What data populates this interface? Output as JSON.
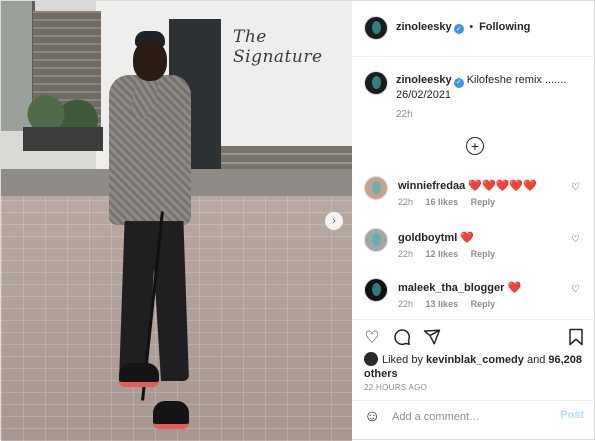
{
  "photo": {
    "sign_text": "The Signature"
  },
  "header": {
    "username": "zinoleesky",
    "separator": "•",
    "follow_state": "Following"
  },
  "caption": {
    "username": "zinoleesky",
    "text": "Kilofeshe remix ....... 26/02/2021",
    "time": "22h"
  },
  "comments": [
    {
      "username": "winniefredaa",
      "text": "❤️❤️❤️❤️❤️",
      "time": "22h",
      "likes": "16 likes",
      "reply": "Reply"
    },
    {
      "username": "goldboytml",
      "text": "❤️",
      "time": "22h",
      "likes": "12 likes",
      "reply": "Reply"
    },
    {
      "username": "maleek_tha_blogger",
      "text": "❤️",
      "time": "22h",
      "likes": "13 likes",
      "reply": "Reply"
    }
  ],
  "likes": {
    "prefix": "Liked by",
    "user": "kevinblak_comedy",
    "and": "and",
    "others": "96,208 others"
  },
  "timestamp": "22 HOURS AGO",
  "add_comment": {
    "placeholder": "Add a comment…",
    "post_label": "Post"
  },
  "colors": {
    "verified": "#3897f0",
    "post_disabled": "#b2dffc",
    "heart": "#ed4956"
  },
  "icons": [
    "verified-icon",
    "plus-icon",
    "heart-icon",
    "comment-icon",
    "share-icon",
    "bookmark-icon",
    "emoji-icon",
    "chevron-right-icon"
  ]
}
